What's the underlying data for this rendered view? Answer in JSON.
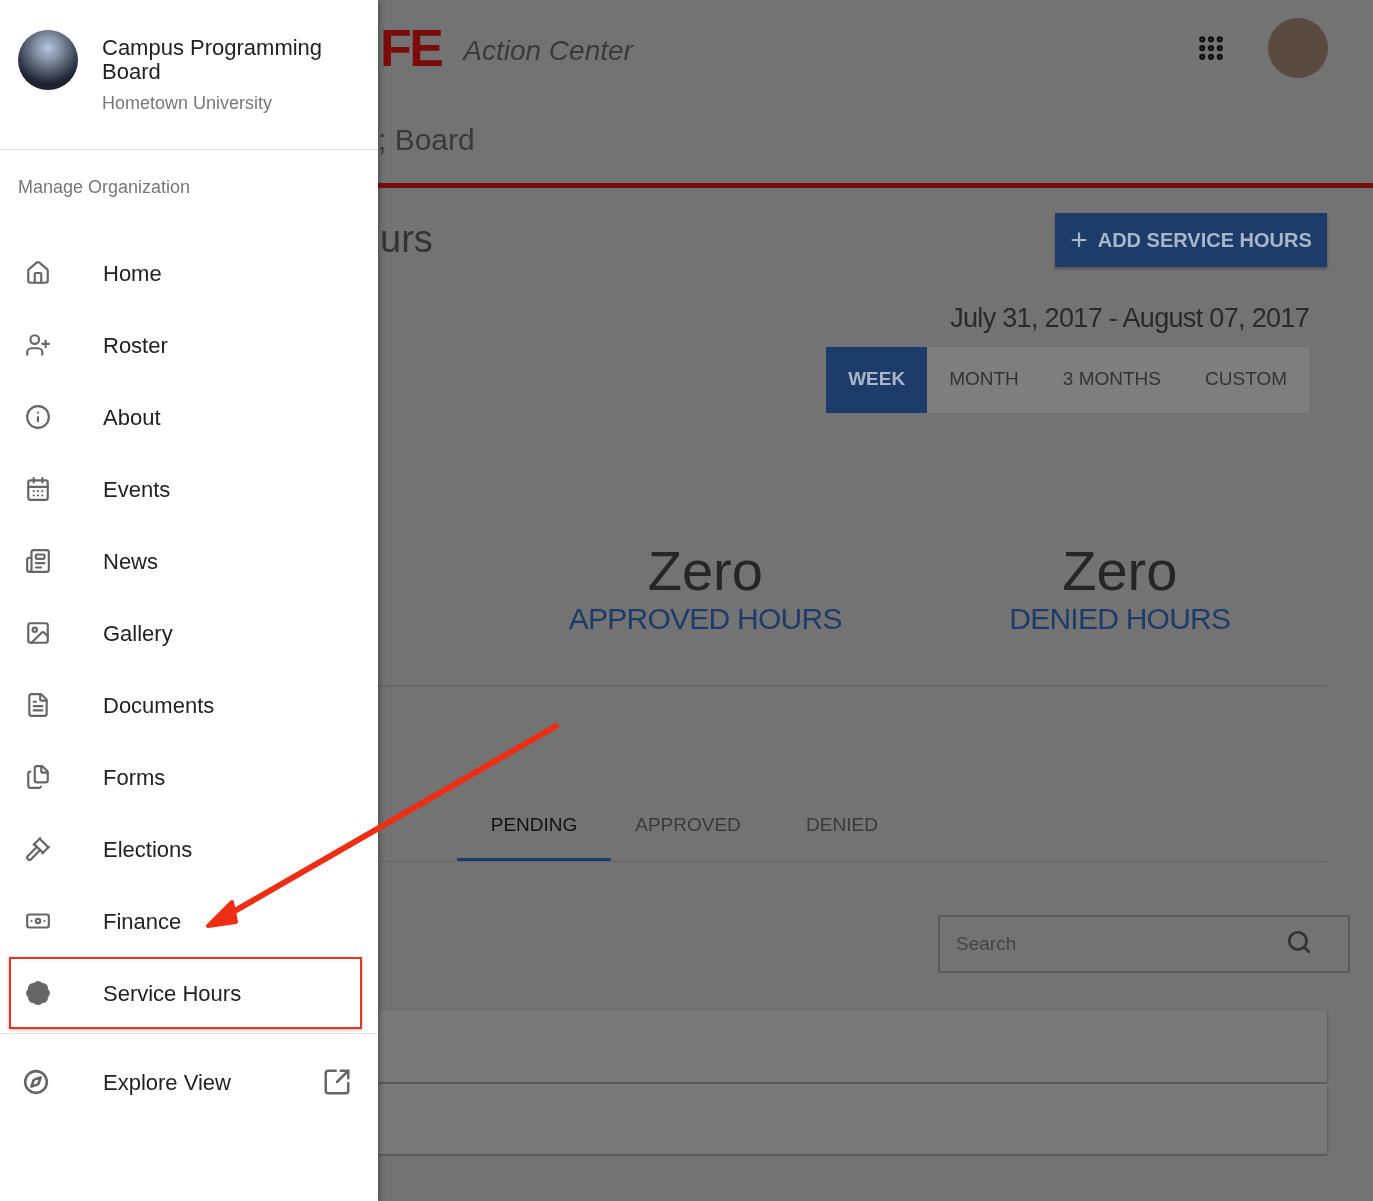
{
  "sidebar": {
    "organization": {
      "name": "Campus Programming Board",
      "school": "Hometown University"
    },
    "section_label": "Manage Organization",
    "items": [
      {
        "label": "Home",
        "kind": "home",
        "highlighted": false
      },
      {
        "label": "Roster",
        "kind": "roster",
        "highlighted": false
      },
      {
        "label": "About",
        "kind": "about",
        "highlighted": false
      },
      {
        "label": "Events",
        "kind": "events",
        "highlighted": false
      },
      {
        "label": "News",
        "kind": "news",
        "highlighted": false
      },
      {
        "label": "Gallery",
        "kind": "gallery",
        "highlighted": false
      },
      {
        "label": "Documents",
        "kind": "documents",
        "highlighted": false
      },
      {
        "label": "Forms",
        "kind": "forms",
        "highlighted": false
      },
      {
        "label": "Elections",
        "kind": "elections",
        "highlighted": false
      },
      {
        "label": "Finance",
        "kind": "finance",
        "highlighted": false
      },
      {
        "label": "Service Hours",
        "kind": "service",
        "highlighted": true
      }
    ],
    "footer_item": {
      "label": "Explore View"
    }
  },
  "header": {
    "logo": "FE",
    "title": "Action Center"
  },
  "org_title": "; Board",
  "page_title": "urs",
  "add_button": {
    "icon": "+",
    "label": "ADD SERVICE HOURS"
  },
  "date_range": "July 31, 2017 - August 07, 2017",
  "period_tabs": [
    {
      "label": "WEEK",
      "selected": true
    },
    {
      "label": "MONTH",
      "selected": false
    },
    {
      "label": "3 MONTHS",
      "selected": false
    },
    {
      "label": "CUSTOM",
      "selected": false
    }
  ],
  "stats": [
    {
      "value": "Zero",
      "label": "APPROVED HOURS"
    },
    {
      "value": "Zero",
      "label": "DENIED HOURS"
    }
  ],
  "status_tabs": [
    {
      "label": "PENDING",
      "selected": true
    },
    {
      "label": "APPROVED",
      "selected": false
    },
    {
      "label": "DENIED",
      "selected": false
    }
  ],
  "search": {
    "placeholder": "Search"
  }
}
